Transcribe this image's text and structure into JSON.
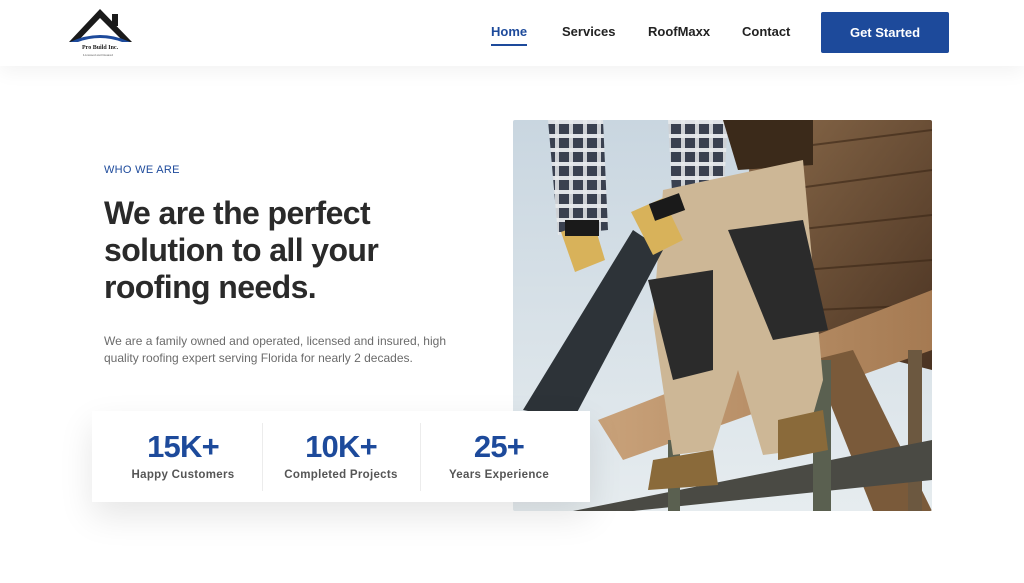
{
  "brand": {
    "name": "Pro Build Inc.",
    "tagline": "Licensed and Insured",
    "colors": {
      "primary": "#1d4a9b",
      "dark": "#1a1a1a"
    }
  },
  "nav": {
    "items": [
      {
        "label": "Home",
        "active": true
      },
      {
        "label": "Services",
        "active": false
      },
      {
        "label": "RoofMaxx",
        "active": false
      },
      {
        "label": "Contact",
        "active": false
      }
    ],
    "cta_label": "Get Started"
  },
  "hero": {
    "eyebrow": "WHO WE ARE",
    "headline": "We are the perfect solution to all your roofing needs.",
    "description": "We are a family owned and operated, licensed and insured, high quality roofing expert serving Florida for nearly 2 decades."
  },
  "stats": [
    {
      "value": "15K+",
      "label": "Happy Customers"
    },
    {
      "value": "10K+",
      "label": "Completed Projects"
    },
    {
      "value": "25+",
      "label": "Years Experience"
    }
  ]
}
